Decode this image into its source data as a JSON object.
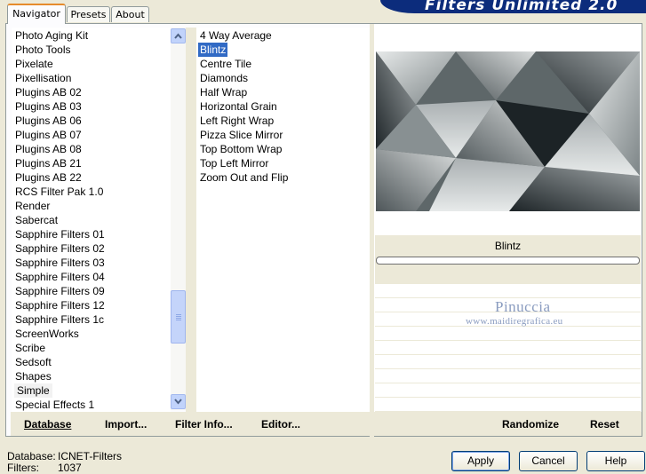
{
  "tabs": [
    {
      "label": "Navigator",
      "active": true
    },
    {
      "label": "Presets",
      "active": false
    },
    {
      "label": "About",
      "active": false
    }
  ],
  "banner": {
    "title": "Filters Unlimited 2.0"
  },
  "categories": {
    "items": [
      "Photo Aging Kit",
      "Photo Tools",
      "Pixelate",
      "Pixellisation",
      "Plugins AB 02",
      "Plugins AB 03",
      "Plugins AB 06",
      "Plugins AB 07",
      "Plugins AB 08",
      "Plugins AB 21",
      "Plugins AB 22",
      "RCS Filter Pak 1.0",
      "Render",
      "Sabercat",
      "Sapphire Filters 01",
      "Sapphire Filters 02",
      "Sapphire Filters 03",
      "Sapphire Filters 04",
      "Sapphire Filters 09",
      "Sapphire Filters 12",
      "Sapphire Filters 1c",
      "ScreenWorks",
      "Scribe",
      "Sedsoft",
      "Shapes",
      "Simple",
      "Special Effects 1"
    ],
    "selected": "Simple"
  },
  "filters": {
    "items": [
      "4 Way Average",
      "Blintz",
      "Centre Tile",
      "Diamonds",
      "Half Wrap",
      "Horizontal Grain",
      "Left Right Wrap",
      "Pizza Slice Mirror",
      "Top Bottom Wrap",
      "Top Left Mirror",
      "Zoom Out and Flip"
    ],
    "selected": "Blintz"
  },
  "panel_actions": {
    "database": "Database",
    "import": "Import...",
    "filter_info": "Filter Info...",
    "editor": "Editor...",
    "randomize": "Randomize",
    "reset": "Reset"
  },
  "preview": {
    "filter_name": "Blintz",
    "progress_fraction": 0
  },
  "watermark": {
    "name": "Pinuccia",
    "url": "www.maidiregrafica.eu"
  },
  "footer": {
    "database_label": "Database:",
    "database_value": "ICNET-Filters",
    "filters_label": "Filters:",
    "filters_value": "1037"
  },
  "buttons": {
    "apply": "Apply",
    "cancel": "Cancel",
    "help": "Help"
  },
  "colors": {
    "selection": "#316ac5",
    "tab_highlight": "#e68b2c",
    "banner": "#0c2c7c"
  }
}
